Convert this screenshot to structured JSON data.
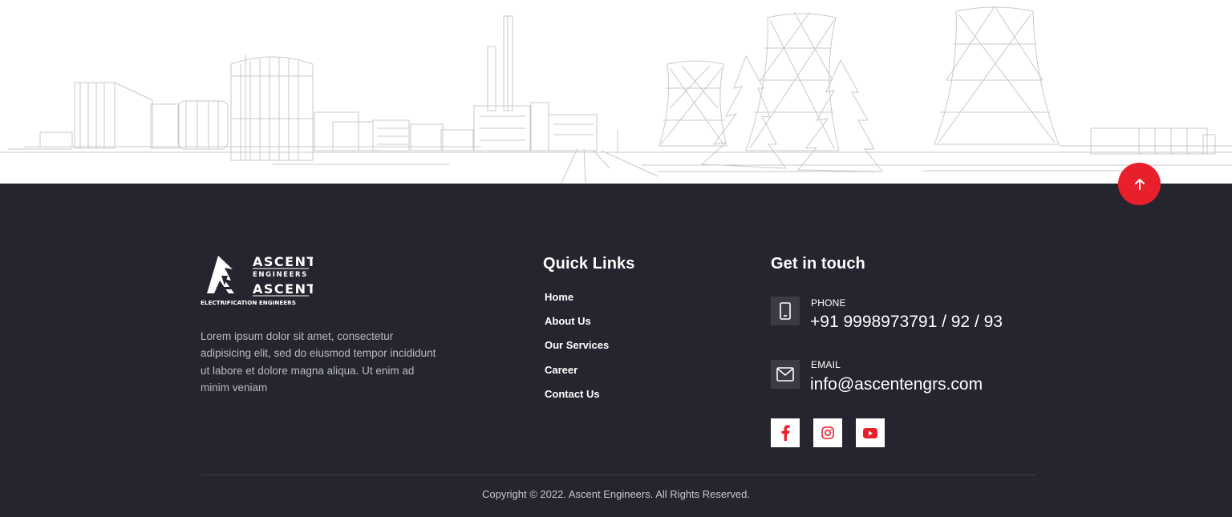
{
  "brand": {
    "logo_top": "ASCENT",
    "logo_top_sub": "ENGINEERS",
    "logo_bottom": "ASCENT",
    "logo_bottom_sub": "ELECTRIFICATION ENGINEERS"
  },
  "about": {
    "text": "Lorem ipsum dolor sit amet, consectetur adipisicing elit, sed do eiusmod tempor incididunt ut labore et dolore magna aliqua. Ut enim ad minim veniam"
  },
  "quick_links": {
    "title": "Quick Links",
    "items": [
      "Home",
      "About Us",
      "Our Services",
      "Career",
      "Contact Us"
    ]
  },
  "contact": {
    "title": "Get in touch",
    "phone_label": "PHONE",
    "phone_value": "+91 9998973791 / 92 / 93",
    "email_label": "EMAIL",
    "email_value": "info@ascentengrs.com"
  },
  "social": {
    "items": [
      "facebook-icon",
      "instagram-icon",
      "youtube-icon"
    ],
    "icon_color": "#e8202b"
  },
  "footer": {
    "copyright": "Copyright © 2022. Ascent Engineers. All Rights Reserved."
  },
  "colors": {
    "background": "#25252f",
    "accent": "#e8202b",
    "icon_box": "#3a3b45",
    "sketch": "#c9c9cc"
  },
  "icons": {
    "back_to_top": "arrow-up-icon",
    "phone": "smartphone-icon",
    "email": "envelope-icon"
  }
}
